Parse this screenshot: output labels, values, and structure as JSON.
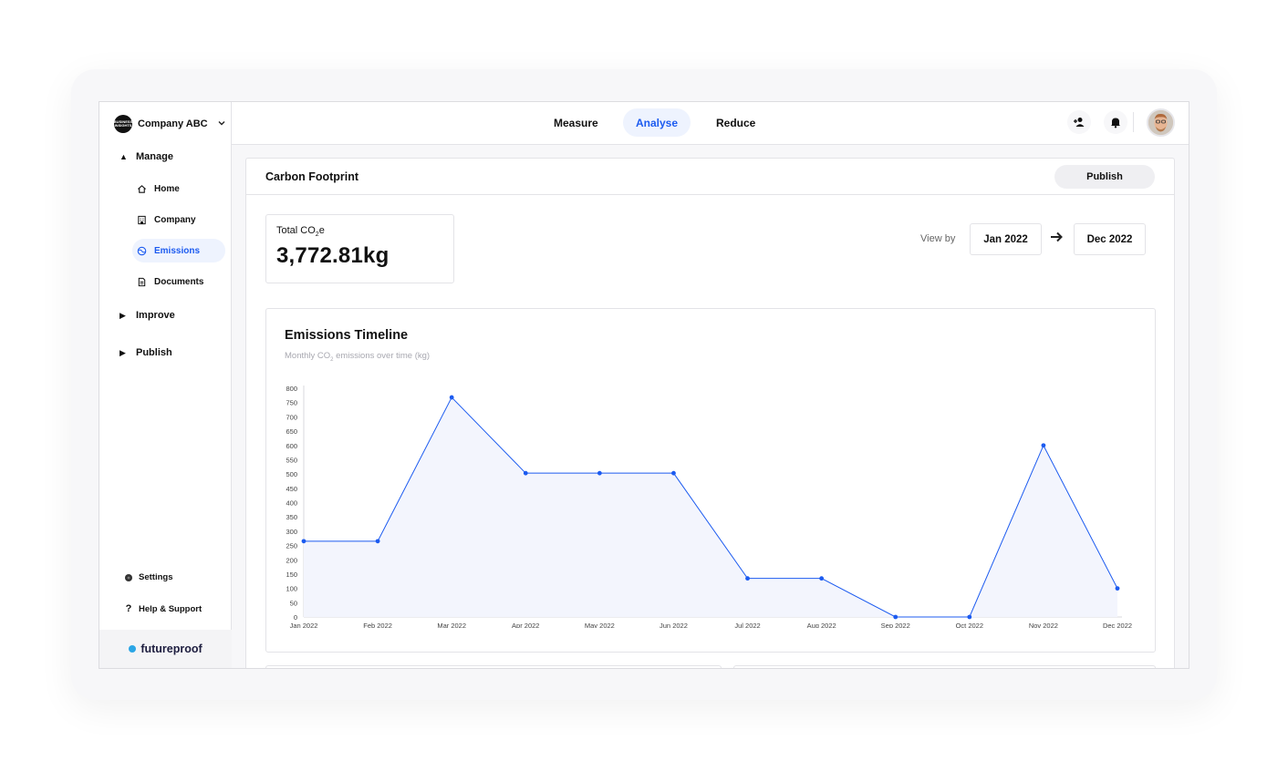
{
  "sidebar": {
    "company_logo_text": "BUSINESS INSIGHTS",
    "company_name": "Company ABC",
    "groups": {
      "manage": "Manage",
      "improve": "Improve",
      "publish": "Publish"
    },
    "items": [
      {
        "label": "Home",
        "icon": "home-icon"
      },
      {
        "label": "Company",
        "icon": "building-icon"
      },
      {
        "label": "Emissions",
        "icon": "globe-icon",
        "active": true
      },
      {
        "label": "Documents",
        "icon": "document-icon"
      }
    ],
    "settings": "Settings",
    "help": "Help & Support",
    "brand": "futureproof",
    "brand_color": "#2ba6e6"
  },
  "topnav": {
    "tabs": [
      "Measure",
      "Analyse",
      "Reduce"
    ],
    "active_tab": "Analyse",
    "accent": "#1c5bf0"
  },
  "page": {
    "title": "Carbon Footprint",
    "publish_label": "Publish",
    "total_label_prefix": "Total CO",
    "total_label_sub": "2",
    "total_label_suffix": "e",
    "total_value": "3,772.81kg",
    "view_by_label": "View by",
    "date_from": "Jan 2022",
    "date_to": "Dec 2022"
  },
  "chart_data": {
    "type": "area",
    "title": "Emissions Timeline",
    "subtitle_prefix": "Monthly CO",
    "subtitle_sub": "2",
    "subtitle_suffix": " emissions over time (kg)",
    "categories": [
      "Jan 2022",
      "Feb 2022",
      "Mar 2022",
      "Apr 2022",
      "May 2022",
      "Jun 2022",
      "Jul 2022",
      "Aug 2022",
      "Sep 2022",
      "Oct 2022",
      "Nov 2022",
      "Dec 2022"
    ],
    "values": [
      265,
      265,
      768,
      503,
      503,
      503,
      135,
      135,
      0,
      0,
      600,
      100
    ],
    "ylim": [
      0,
      800
    ],
    "yticks": [
      0,
      50,
      100,
      150,
      200,
      250,
      300,
      350,
      400,
      450,
      500,
      550,
      600,
      650,
      700,
      750,
      800
    ],
    "line_color": "#1c5bf0",
    "fill_color": "#f3f5fd",
    "grid": false
  }
}
